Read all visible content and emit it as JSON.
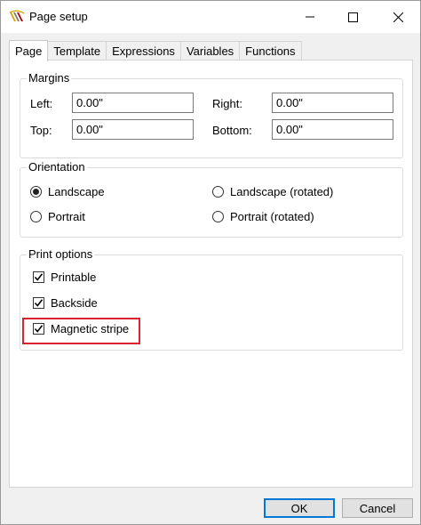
{
  "window": {
    "title": "Page setup",
    "controls": {
      "minimize": "minimize-icon",
      "maximize": "maximize-icon",
      "close": "close-icon"
    }
  },
  "tabs": [
    {
      "label": "Page",
      "active": true
    },
    {
      "label": "Template",
      "active": false
    },
    {
      "label": "Expressions",
      "active": false
    },
    {
      "label": "Variables",
      "active": false
    },
    {
      "label": "Functions",
      "active": false
    }
  ],
  "margins": {
    "title": "Margins",
    "left_label": "Left:",
    "left_value": "0.00\"",
    "right_label": "Right:",
    "right_value": "0.00\"",
    "top_label": "Top:",
    "top_value": "0.00\"",
    "bottom_label": "Bottom:",
    "bottom_value": "0.00\""
  },
  "orientation": {
    "title": "Orientation",
    "options": [
      {
        "label": "Landscape",
        "selected": true
      },
      {
        "label": "Landscape (rotated)",
        "selected": false
      },
      {
        "label": "Portrait",
        "selected": false
      },
      {
        "label": "Portrait (rotated)",
        "selected": false
      }
    ]
  },
  "print_options": {
    "title": "Print options",
    "items": [
      {
        "label": "Printable",
        "checked": true
      },
      {
        "label": "Backside",
        "checked": true
      },
      {
        "label": "Magnetic stripe",
        "checked": true
      }
    ]
  },
  "buttons": {
    "ok": "OK",
    "cancel": "Cancel"
  },
  "colors": {
    "highlight": "#d9232e",
    "accent": "#0078d7"
  }
}
